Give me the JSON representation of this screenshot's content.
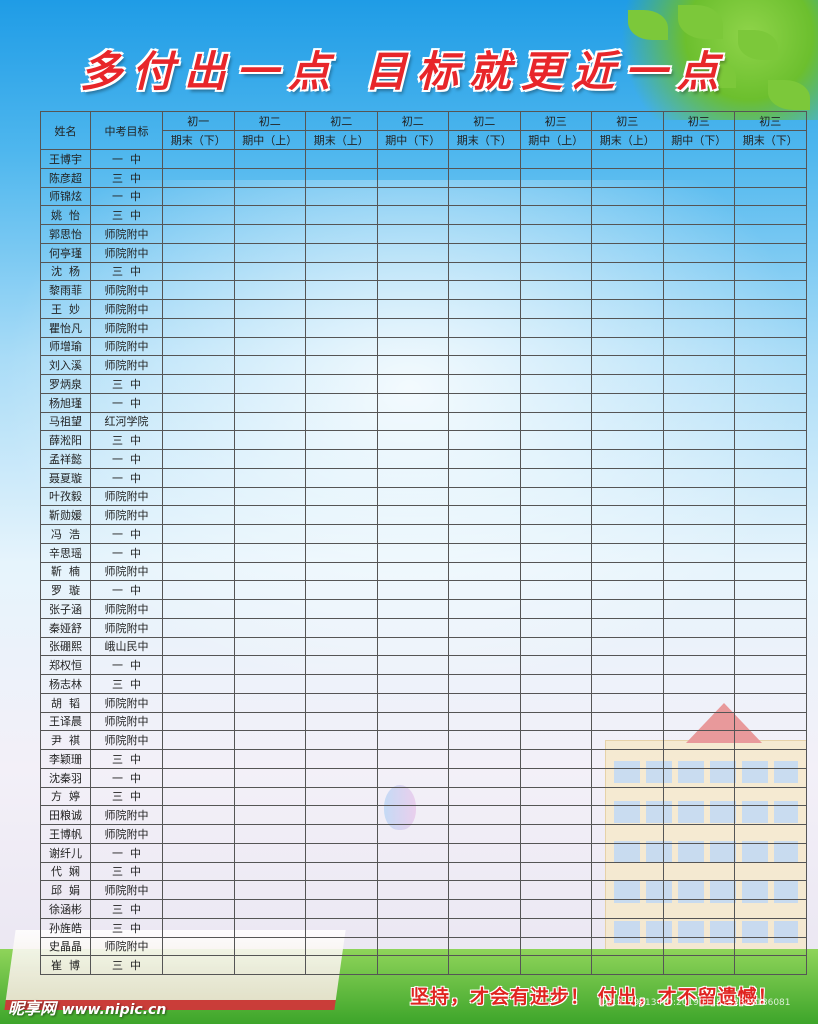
{
  "title": "多付出一点  目标就更近一点",
  "table": {
    "name_header": "姓名",
    "goal_header": "中考目标",
    "periods": [
      {
        "grade": "初一",
        "term": "期末（下）"
      },
      {
        "grade": "初二",
        "term": "期中（上）"
      },
      {
        "grade": "初二",
        "term": "期末（上）"
      },
      {
        "grade": "初二",
        "term": "期中（下）"
      },
      {
        "grade": "初二",
        "term": "期末（下）"
      },
      {
        "grade": "初三",
        "term": "期中（上）"
      },
      {
        "grade": "初三",
        "term": "期末（上）"
      },
      {
        "grade": "初三",
        "term": "期中（下）"
      },
      {
        "grade": "初三",
        "term": "期末（下）"
      }
    ],
    "rows": [
      {
        "name": "王博宇",
        "goal": "一  中"
      },
      {
        "name": "陈彦超",
        "goal": "三  中"
      },
      {
        "name": "师锦炫",
        "goal": "一  中"
      },
      {
        "name": "姚  怡",
        "goal": "三  中"
      },
      {
        "name": "郭思怡",
        "goal": "师院附中"
      },
      {
        "name": "何亭瑾",
        "goal": "师院附中"
      },
      {
        "name": "沈  杨",
        "goal": "三  中"
      },
      {
        "name": "黎雨菲",
        "goal": "师院附中"
      },
      {
        "name": "王  妙",
        "goal": "师院附中"
      },
      {
        "name": "瞿怡凡",
        "goal": "师院附中"
      },
      {
        "name": "师增瑜",
        "goal": "师院附中"
      },
      {
        "name": "刘入溪",
        "goal": "师院附中"
      },
      {
        "name": "罗炳泉",
        "goal": "三  中"
      },
      {
        "name": "杨旭瑾",
        "goal": "一  中"
      },
      {
        "name": "马祖望",
        "goal": "红河学院"
      },
      {
        "name": "薛淞阳",
        "goal": "三  中"
      },
      {
        "name": "孟祥懿",
        "goal": "一  中"
      },
      {
        "name": "聂夏璇",
        "goal": "一  中"
      },
      {
        "name": "叶孜毅",
        "goal": "师院附中"
      },
      {
        "name": "靳勋媛",
        "goal": "师院附中"
      },
      {
        "name": "冯  浩",
        "goal": "一  中"
      },
      {
        "name": "辛思瑶",
        "goal": "一  中"
      },
      {
        "name": "靳  楠",
        "goal": "师院附中"
      },
      {
        "name": "罗  璇",
        "goal": "一  中"
      },
      {
        "name": "张子涵",
        "goal": "师院附中"
      },
      {
        "name": "秦娅舒",
        "goal": "师院附中"
      },
      {
        "name": "张硼熙",
        "goal": "峨山民中"
      },
      {
        "name": "郑权恒",
        "goal": "一  中"
      },
      {
        "name": "杨志林",
        "goal": "三  中"
      },
      {
        "name": "胡  韬",
        "goal": "师院附中"
      },
      {
        "name": "王译晨",
        "goal": "师院附中"
      },
      {
        "name": "尹  祺",
        "goal": "师院附中"
      },
      {
        "name": "李颖珊",
        "goal": "三  中"
      },
      {
        "name": "沈秦羽",
        "goal": "一  中"
      },
      {
        "name": "方  婷",
        "goal": "三  中"
      },
      {
        "name": "田粮诚",
        "goal": "师院附中"
      },
      {
        "name": "王博帆",
        "goal": "师院附中"
      },
      {
        "name": "谢纤儿",
        "goal": "一  中"
      },
      {
        "name": "代  娴",
        "goal": "三  中"
      },
      {
        "name": "邱  娟",
        "goal": "师院附中"
      },
      {
        "name": "徐涵彬",
        "goal": "三  中"
      },
      {
        "name": "孙旌皓",
        "goal": "三  中"
      },
      {
        "name": "史晶晶",
        "goal": "师院附中"
      },
      {
        "name": "崔  博",
        "goal": "三  中"
      }
    ]
  },
  "slogan": "坚持，才会有进步！  付出，才不留遗憾！",
  "logo": {
    "brand": "昵享网",
    "url": "www.nipic.cn"
  },
  "watermark": "ID:13179313 NO:20190115152329186081"
}
